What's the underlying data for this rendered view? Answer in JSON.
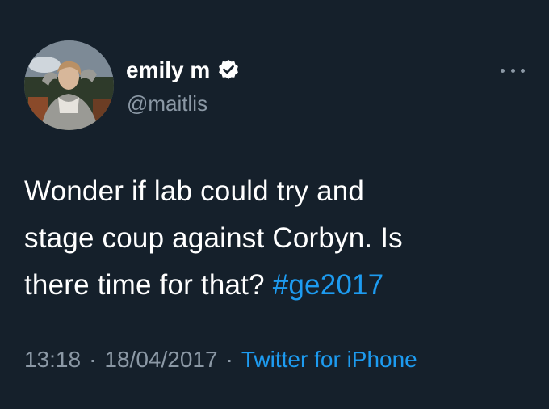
{
  "colors": {
    "background": "#15202b",
    "primary_text": "#ffffff",
    "secondary_text": "#8b98a5",
    "accent": "#1d9bf0",
    "divider": "#38444d"
  },
  "author": {
    "display_name": "emily m",
    "handle": "@maitlis",
    "verified_icon": "verified-badge-icon",
    "avatar_icon": "profile-photo"
  },
  "menu_icon": "more-options-icon",
  "tweet": {
    "lines": [
      "Wonder if lab could try and",
      "stage coup against Corbyn. Is",
      "there time for that?"
    ],
    "hashtag": "#ge2017"
  },
  "meta": {
    "time": "13:18",
    "separator": "·",
    "date": "18/04/2017",
    "source": "Twitter for iPhone"
  }
}
